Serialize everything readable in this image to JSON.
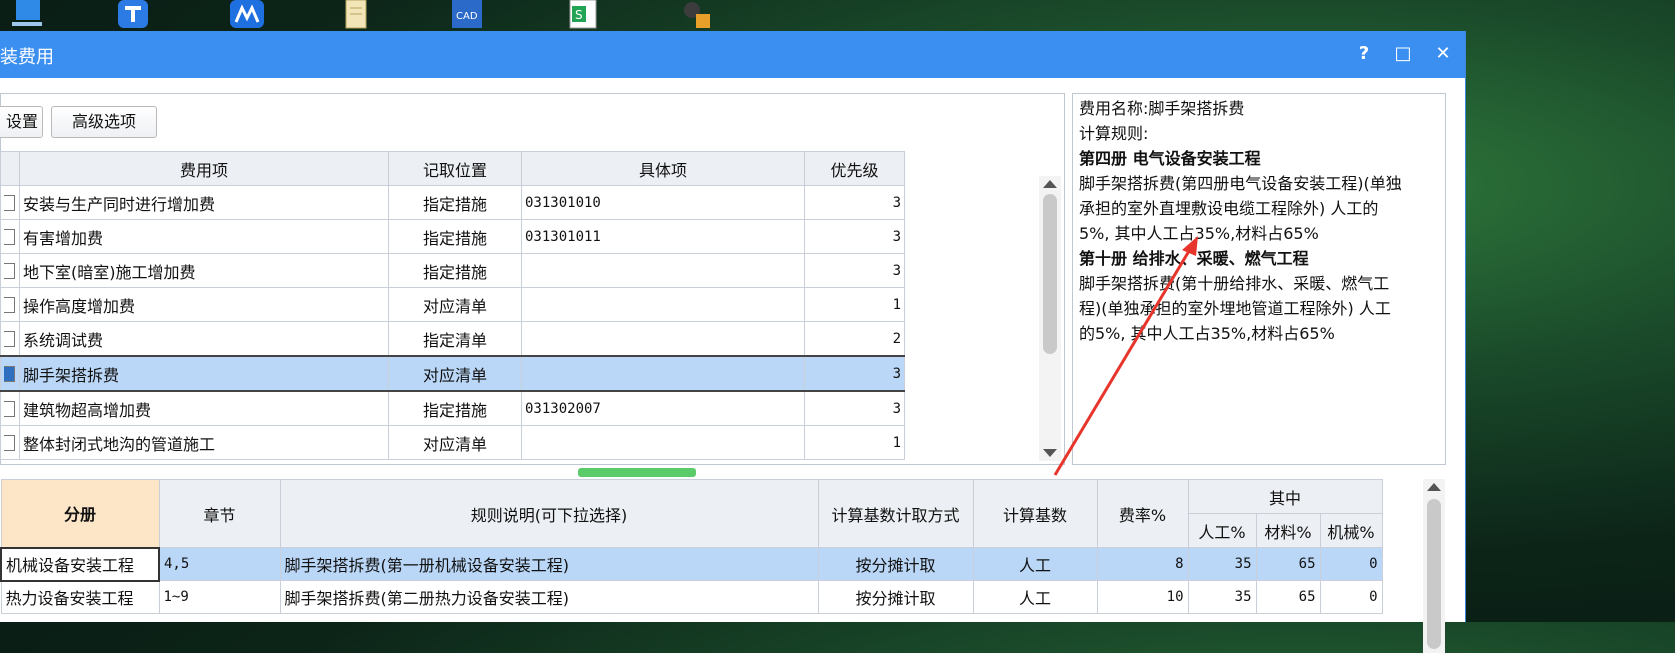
{
  "window": {
    "title": "装费用",
    "help": "?",
    "maximize": "□",
    "close": "✕"
  },
  "toolbar": {
    "settings_label": "设置",
    "advanced_label": "高级选项"
  },
  "fee_table": {
    "headers": [
      "费用项",
      "记取位置",
      "具体项",
      "优先级"
    ],
    "rows": [
      {
        "name": "安装与生产同时进行增加费",
        "position": "指定措施",
        "detail": "031301010",
        "priority": "3"
      },
      {
        "name": "有害增加费",
        "position": "指定措施",
        "detail": "031301011",
        "priority": "3"
      },
      {
        "name": "地下室(暗室)施工增加费",
        "position": "指定措施",
        "detail": "",
        "priority": "3"
      },
      {
        "name": "操作高度增加费",
        "position": "对应清单",
        "detail": "",
        "priority": "1"
      },
      {
        "name": "系统调试费",
        "position": "指定清单",
        "detail": "",
        "priority": "2"
      },
      {
        "name": "脚手架搭拆费",
        "position": "对应清单",
        "detail": "",
        "priority": "3"
      },
      {
        "name": "建筑物超高增加费",
        "position": "指定措施",
        "detail": "031302007",
        "priority": "3"
      },
      {
        "name": "整体封闭式地沟的管道施工",
        "position": "对应清单",
        "detail": "",
        "priority": "1"
      }
    ]
  },
  "description": {
    "name_line": "费用名称:脚手架搭拆费",
    "rule_label": "计算规则:",
    "section1_title": "第四册 电气设备安装工程",
    "section1_lines": [
      "脚手架搭拆费(第四册电气设备安装工程)(单独",
      "承担的室外直埋敷设电缆工程除外) 人工的",
      "5%, 其中人工占35%,材料占65%"
    ],
    "section2_title": "第十册 给排水、采暖、燃气工程",
    "section2_lines": [
      "脚手架搭拆费(第十册给排水、采暖、燃气工",
      "程)(单独承担的室外埋地管道工程除外) 人工",
      "的5%, 其中人工占35%,材料占65%"
    ]
  },
  "rule_table": {
    "headers": {
      "volume": "分册",
      "chapter": "章节",
      "rule": "规则说明(可下拉选择)",
      "base_method": "计算基数计取方式",
      "base": "计算基数",
      "rate": "费率%",
      "of_which": "其中",
      "labor": "人工%",
      "material": "材料%",
      "machine": "机械%"
    },
    "rows": [
      {
        "volume": "机械设备安装工程",
        "chapter": "4,5",
        "rule": "脚手架搭拆费(第一册机械设备安装工程)",
        "base_method": "按分摊计取",
        "base": "人工",
        "rate": "8",
        "labor": "35",
        "material": "65",
        "machine": "0"
      },
      {
        "volume": "热力设备安装工程",
        "chapter": "1~9",
        "rule": "脚手架搭拆费(第二册热力设备安装工程)",
        "base_method": "按分摊计取",
        "base": "人工",
        "rate": "10",
        "labor": "35",
        "material": "65",
        "machine": "0"
      }
    ]
  },
  "colors": {
    "titlebar": "#3a8ff0",
    "selection": "#bad7f7",
    "annotation": "#e8352b"
  }
}
